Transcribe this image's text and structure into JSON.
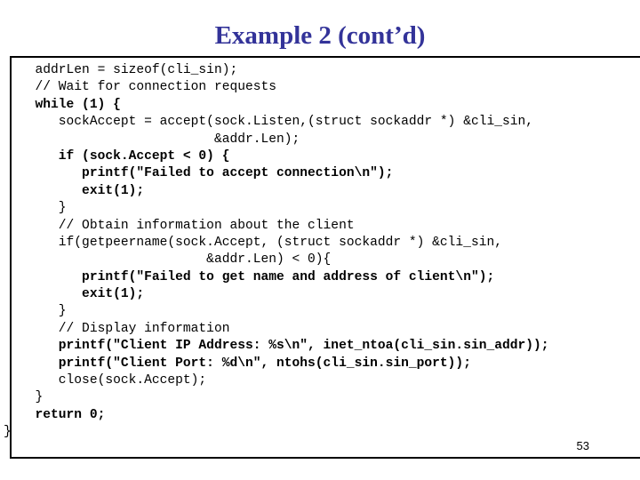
{
  "slide": {
    "title": "Example 2 (cont’d)",
    "title_color": "#333399",
    "page_number": "53",
    "background_color": "#ffffff",
    "border_color": "#000000"
  },
  "code": {
    "language": "c",
    "lines": [
      {
        "text": "  addrLen = sizeof(cli_sin);",
        "bold": false
      },
      {
        "text": "  // Wait for connection requests",
        "bold": false
      },
      {
        "text": "  while (1) {",
        "bold": true
      },
      {
        "text": "     sockAccept = accept(sock.Listen,(struct sockaddr *) &cli_sin,",
        "bold": false
      },
      {
        "text": "                         &addr.Len);",
        "bold": false
      },
      {
        "text": "     if (sock.Accept < 0) {",
        "bold": true
      },
      {
        "text": "        printf(\"Failed to accept connection\\n\");",
        "bold": true
      },
      {
        "text": "        exit(1);",
        "bold": true
      },
      {
        "text": "     }",
        "bold": false
      },
      {
        "text": "     // Obtain information about the client",
        "bold": false
      },
      {
        "text": "     if(getpeername(sock.Accept, (struct sockaddr *) &cli_sin,",
        "bold": false
      },
      {
        "text": "                        &addr.Len) < 0){",
        "bold": false
      },
      {
        "text": "        printf(\"Failed to get name and address of client\\n\");",
        "bold": true
      },
      {
        "text": "        exit(1);",
        "bold": true
      },
      {
        "text": "     }",
        "bold": false
      },
      {
        "text": "     // Display information",
        "bold": false
      },
      {
        "text": "     printf(\"Client IP Address: %s\\n\", inet_ntoa(cli_sin.sin_addr));",
        "bold": true
      },
      {
        "text": "     printf(\"Client Port: %d\\n\", ntohs(cli_sin.sin_port));",
        "bold": true
      },
      {
        "text": "     close(sock.Accept);",
        "bold": false
      },
      {
        "text": "  }",
        "bold": false
      },
      {
        "text": "  return 0;",
        "bold": true
      },
      {
        "text": "}",
        "bold": false,
        "outdent": true
      }
    ]
  }
}
